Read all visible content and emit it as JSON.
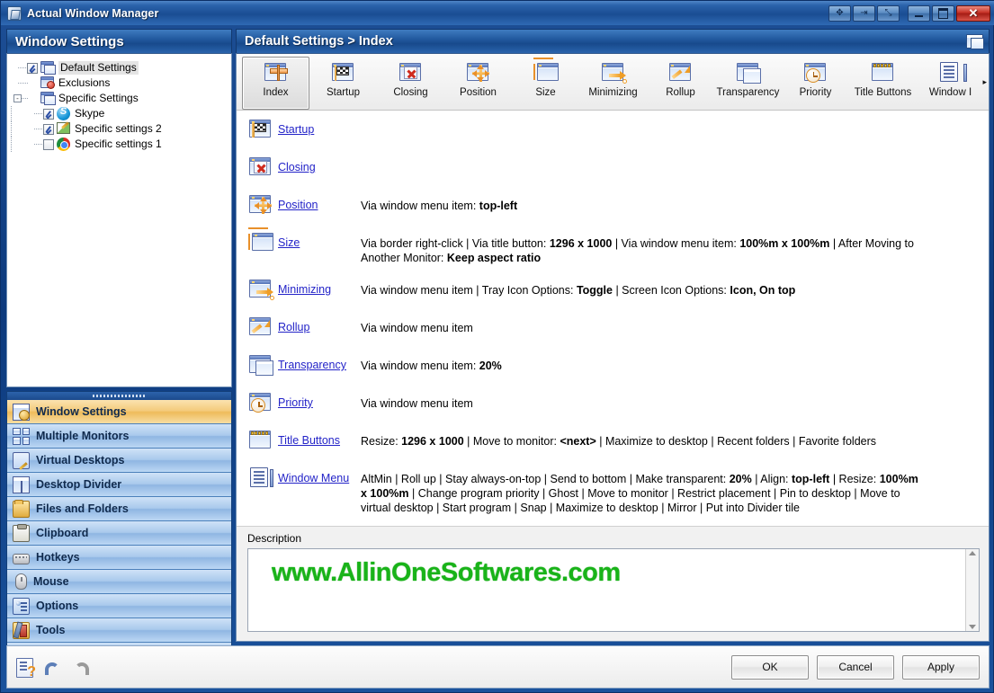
{
  "window": {
    "title": "Actual Window Manager",
    "icon": "app-icon",
    "extra_buttons": [
      {
        "name": "move-window-button",
        "glyph": "✥"
      },
      {
        "name": "send-to-monitor-button",
        "glyph": "⇥"
      },
      {
        "name": "maximize-to-desktop-button",
        "glyph": "⤡"
      }
    ],
    "controls": {
      "minimize": "–",
      "maximize": "❐",
      "close": "✕"
    }
  },
  "sidebar": {
    "header": "Window Settings",
    "tree": [
      {
        "label": "Default Settings",
        "checkbox": "checked",
        "icon": "window-icon",
        "level": 1,
        "selected": true,
        "expander": ""
      },
      {
        "label": "Exclusions",
        "checkbox": "none",
        "icon": "window-exclude-icon",
        "level": 1,
        "selected": false,
        "expander": ""
      },
      {
        "label": "Specific Settings",
        "checkbox": "none",
        "icon": "window-group-icon",
        "level": 1,
        "selected": false,
        "expander": "-"
      },
      {
        "label": "Skype",
        "checkbox": "checked",
        "icon": "skype-icon",
        "level": 2,
        "selected": false,
        "expander": ""
      },
      {
        "label": "Specific settings 2",
        "checkbox": "checked",
        "icon": "pencil-icon",
        "level": 2,
        "selected": false,
        "expander": ""
      },
      {
        "label": "Specific settings 1",
        "checkbox": "unchecked",
        "icon": "chrome-icon",
        "level": 2,
        "selected": false,
        "expander": ""
      }
    ],
    "nav": [
      {
        "label": "Window Settings",
        "icon": "window-settings-icon",
        "active": true
      },
      {
        "label": "Multiple Monitors",
        "icon": "multiple-monitors-icon",
        "active": false
      },
      {
        "label": "Virtual Desktops",
        "icon": "virtual-desktops-icon",
        "active": false
      },
      {
        "label": "Desktop Divider",
        "icon": "desktop-divider-icon",
        "active": false
      },
      {
        "label": "Files and Folders",
        "icon": "folder-icon",
        "active": false
      },
      {
        "label": "Clipboard",
        "icon": "clipboard-icon",
        "active": false
      },
      {
        "label": "Hotkeys",
        "icon": "keyboard-icon",
        "active": false
      },
      {
        "label": "Mouse",
        "icon": "mouse-icon",
        "active": false
      },
      {
        "label": "Options",
        "icon": "options-icon",
        "active": false
      },
      {
        "label": "Tools",
        "icon": "tools-icon",
        "active": false
      }
    ],
    "more_chevron": "»"
  },
  "right_panel": {
    "header_title": "Default Settings > Index",
    "header_icon": "window-restore-icon",
    "toolbar": [
      {
        "label": "Index",
        "icon": "index-signpost-icon",
        "selected": true
      },
      {
        "label": "Startup",
        "icon": "startup-flag-icon",
        "selected": false
      },
      {
        "label": "Closing",
        "icon": "closing-x-icon",
        "selected": false
      },
      {
        "label": "Position",
        "icon": "position-move-icon",
        "selected": false
      },
      {
        "label": "Size",
        "icon": "size-arrows-icon",
        "selected": false
      },
      {
        "label": "Minimizing",
        "icon": "minimizing-arrow-icon",
        "selected": false
      },
      {
        "label": "Rollup",
        "icon": "rollup-arrow-icon",
        "selected": false
      },
      {
        "label": "Transparency",
        "icon": "transparency-stack-icon",
        "selected": false
      },
      {
        "label": "Priority",
        "icon": "priority-clock-icon",
        "selected": false
      },
      {
        "label": "Title Buttons",
        "icon": "title-buttons-icon",
        "selected": false
      },
      {
        "label": "Window I",
        "icon": "window-menu-doc-icon",
        "selected": false
      }
    ],
    "toolbar_overflow": "▸",
    "rows": [
      {
        "link": "Startup",
        "icon": "startup-flag-icon",
        "lines": [
          []
        ]
      },
      {
        "link": "Closing",
        "icon": "closing-x-icon",
        "lines": [
          []
        ]
      },
      {
        "link": "Position",
        "icon": "position-move-icon",
        "lines": [
          [
            {
              "t": "Via window menu item: ",
              "b": false
            },
            {
              "t": "top-left",
              "b": true
            }
          ]
        ]
      },
      {
        "link": "Size",
        "icon": "size-arrows-icon",
        "lines": [
          [
            {
              "t": "Via border right-click | Via title button: ",
              "b": false
            },
            {
              "t": "1296 x 1000",
              "b": true
            },
            {
              "t": " | Via window menu item: ",
              "b": false
            },
            {
              "t": "100%m x 100%m",
              "b": true
            },
            {
              "t": " | After Moving to",
              "b": false
            }
          ],
          [
            {
              "t": " Another Monitor: ",
              "b": false
            },
            {
              "t": "Keep aspect ratio",
              "b": true
            }
          ]
        ]
      },
      {
        "link": "Minimizing",
        "icon": "minimizing-arrow-icon",
        "lines": [
          [
            {
              "t": "Via window menu item | Tray Icon Options: ",
              "b": false
            },
            {
              "t": "Toggle",
              "b": true
            },
            {
              "t": " | Screen Icon Options: ",
              "b": false
            },
            {
              "t": "Icon, On top",
              "b": true
            }
          ]
        ]
      },
      {
        "link": "Rollup",
        "icon": "rollup-arrow-icon",
        "lines": [
          [
            {
              "t": "Via window menu item",
              "b": false
            }
          ]
        ]
      },
      {
        "link": "Transparency",
        "icon": "transparency-stack-icon",
        "lines": [
          [
            {
              "t": "Via window menu item: ",
              "b": false
            },
            {
              "t": "20%",
              "b": true
            }
          ]
        ]
      },
      {
        "link": "Priority",
        "icon": "priority-clock-icon",
        "lines": [
          [
            {
              "t": "Via window menu item",
              "b": false
            }
          ]
        ]
      },
      {
        "link": "Title Buttons",
        "icon": "title-buttons-icon",
        "lines": [
          [
            {
              "t": "Resize: ",
              "b": false
            },
            {
              "t": "1296 x 1000",
              "b": true
            },
            {
              "t": " | Move to monitor: ",
              "b": false
            },
            {
              "t": "<next>",
              "b": true
            },
            {
              "t": " | Maximize to desktop | Recent folders | Favorite folders",
              "b": false
            }
          ]
        ]
      },
      {
        "link": "Window Menu",
        "icon": "window-menu-doc-icon",
        "lines": [
          [
            {
              "t": "AltMin | Roll up | Stay always-on-top | Send to bottom | Make transparent: ",
              "b": false
            },
            {
              "t": "20%",
              "b": true
            },
            {
              "t": " | Align: ",
              "b": false
            },
            {
              "t": "top-left",
              "b": true
            },
            {
              "t": " | Resize: ",
              "b": false
            },
            {
              "t": "100%m",
              "b": true
            }
          ],
          [
            {
              "t": "x 100%m",
              "b": true
            },
            {
              "t": " | Change program priority | Ghost | Move to monitor | Restrict placement | Pin to desktop | Move to",
              "b": false
            }
          ],
          [
            {
              "t": "virtual desktop | Start program | Snap | Maximize to desktop | Mirror | Put into Divider tile",
              "b": false
            }
          ]
        ]
      }
    ],
    "description_label": "Description",
    "description_value": "",
    "description_watermark": "www.AllinOneSoftwares.com",
    "scrollbar": {
      "up": "▲",
      "down": "▼"
    }
  },
  "bottom_bar": {
    "icons": [
      {
        "name": "help-icon"
      },
      {
        "name": "undo-icon"
      },
      {
        "name": "redo-icon"
      }
    ],
    "buttons": [
      {
        "label": "OK",
        "name": "ok-button"
      },
      {
        "label": "Cancel",
        "name": "cancel-button"
      },
      {
        "label": "Apply",
        "name": "apply-button"
      }
    ]
  }
}
